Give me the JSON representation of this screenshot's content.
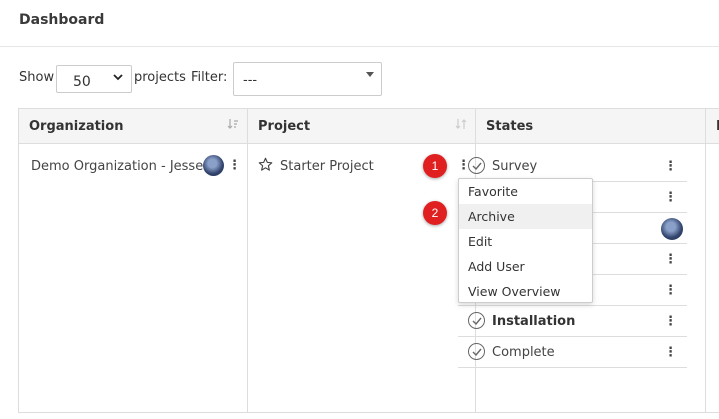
{
  "header": {
    "title": "Dashboard"
  },
  "controls": {
    "show_label": "Show",
    "show_value": "50",
    "projects_label": "projects",
    "filter_label": "Filter:",
    "filter_value": "---"
  },
  "table": {
    "columns": [
      {
        "label": "Organization"
      },
      {
        "label": "Project"
      },
      {
        "label": "States"
      },
      {
        "label": "P"
      }
    ],
    "organization": "Demo Organization - Jesse",
    "project": "Starter Project",
    "states": [
      {
        "label": "Survey",
        "bold": false
      },
      {
        "label": "",
        "bold": false
      },
      {
        "label": "",
        "bold": false
      },
      {
        "label": "",
        "bold": false
      },
      {
        "label": "",
        "bold": false
      },
      {
        "label": "Installation",
        "bold": true
      },
      {
        "label": "Complete",
        "bold": false
      }
    ]
  },
  "menu": {
    "items": [
      "Favorite",
      "Archive",
      "Edit",
      "Add User",
      "View Overview"
    ]
  },
  "badges": [
    "1",
    "2"
  ],
  "icons": {
    "kebab": "⋮",
    "star": "☆",
    "sort_org": "↓≡",
    "sort_proj": "↓↑",
    "chevron": "⌄"
  },
  "colors": {
    "badge": "#e02020",
    "menu_hover": "#f0f0f0"
  }
}
